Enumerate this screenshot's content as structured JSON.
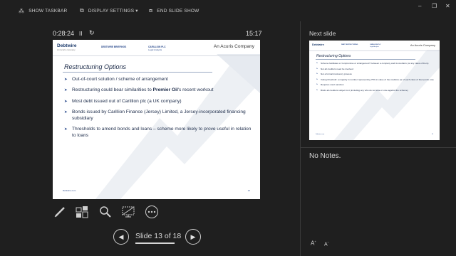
{
  "toolbar": {
    "show_taskbar": "SHOW TASKBAR",
    "display_settings": "DISPLAY SETTINGS ▾",
    "end_slide_show": "END SLIDE SHOW"
  },
  "window_controls": {
    "minimize": "–",
    "restore": "❐",
    "close": "✕"
  },
  "timer": {
    "elapsed": "0:28:24",
    "pause": "II",
    "reset": "↻",
    "clock": "15:17"
  },
  "current_slide": {
    "logo": "Debtwire",
    "logo_tagline": "An Acuris company",
    "header_tab": "DEBTWIRE BRIEFINGS",
    "header_sub": "CARILLION PLC",
    "header_sub2": "Legal Analysis",
    "company": "An Acuris Company",
    "title": "Restructuring Options",
    "bullets": [
      "Out-of-court solution / scheme of arrangement",
      "Restructuring could bear similarities to ",
      "Most debt issued out of Carillion plc (a UK company)",
      "Bonds issued by Carillion Finance (Jersey) Limited, a Jersey-incorporated financing subsidiary",
      "Thresholds to amend bonds and loans – scheme more likely to prove useful in relation to loans"
    ],
    "bullet2_bold": "Premier Oil",
    "bullet2_tail": "'s recent workout",
    "footer": "Debtwire.com",
    "page_num": "12"
  },
  "tools": [
    "pen-icon",
    "slides-grid-icon",
    "zoom-icon",
    "black-screen-icon",
    "more-options-icon"
  ],
  "navigation": {
    "prev": "◀",
    "next": "▶",
    "counter": "Slide 13 of 18"
  },
  "next_panel": {
    "label": "Next slide",
    "logo": "Debtwire",
    "tab": "DEBT RESTRUCTURING",
    "sub": "CARILLION PLC",
    "sub2": "Legal Analysis",
    "company": "An Acuris Company",
    "title": "Restructuring Options",
    "bullets": [
      "Scheme facilitates a \"compromise or arrangement\" between a company and its creditors (or any class of them)",
      "Not all creditors need be involved",
      "Not a formal insolvency process",
      "Voting threshold: a majority in number representing 75% in value of the creditors (or of each class of them) who vote",
      "Requires court sanction",
      "Binds all creditors subject to it (including any who do not vote or vote against the scheme)"
    ],
    "footer": "Debtwire.com",
    "page_num": "13"
  },
  "notes": {
    "text": "No Notes."
  },
  "font_controls": {
    "increase": "A",
    "decrease": "A"
  }
}
